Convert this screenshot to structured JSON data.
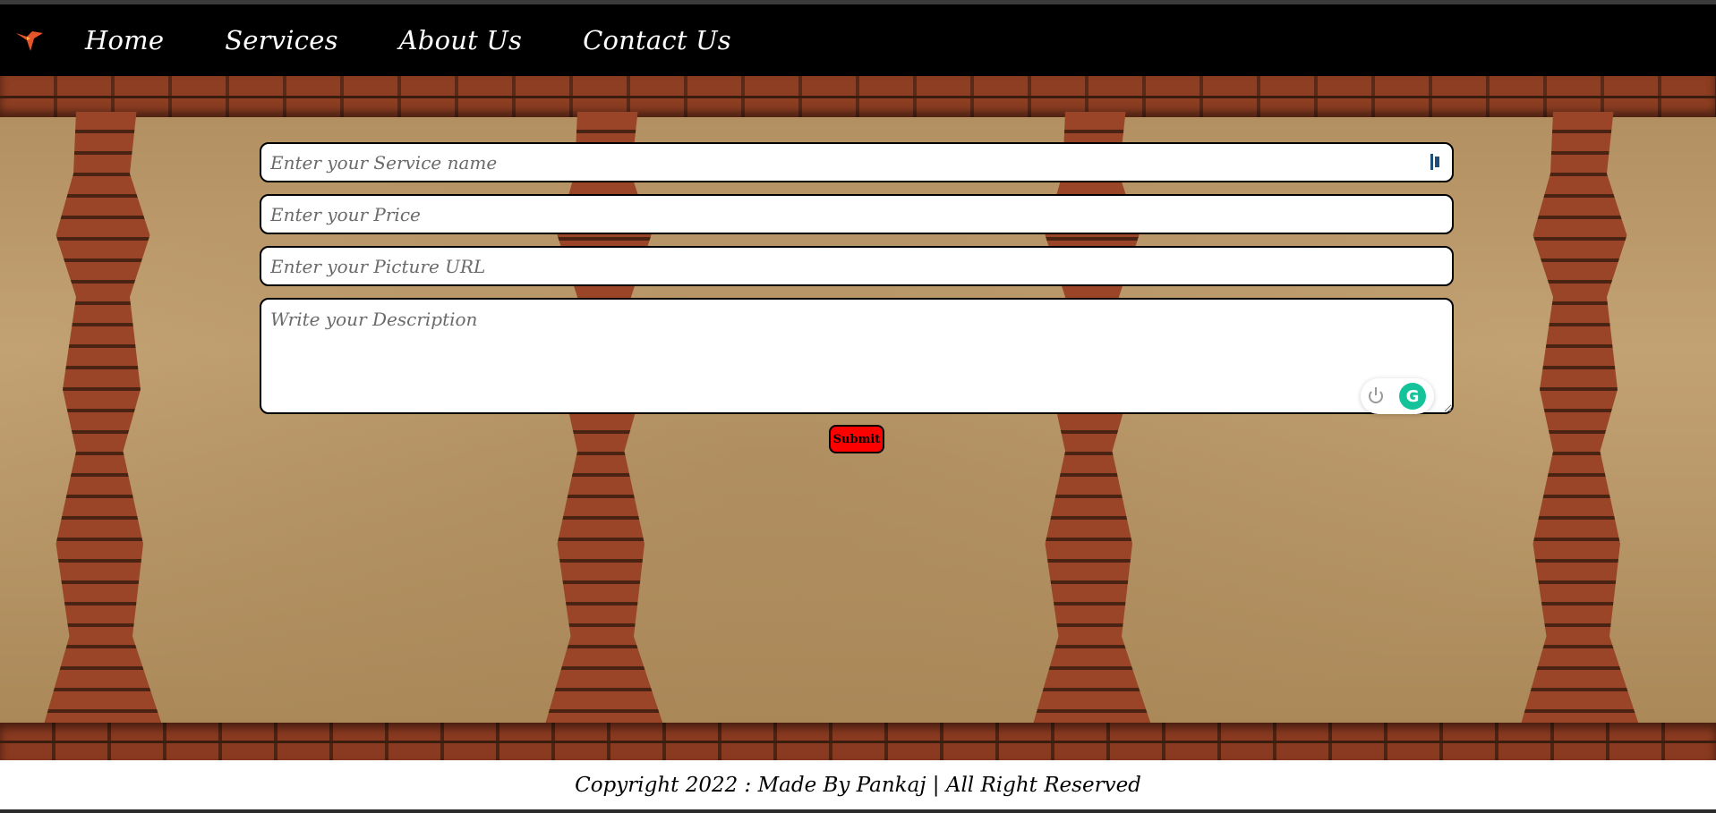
{
  "nav": {
    "logo": "hummingbird-logo",
    "links": [
      "Home",
      "Services",
      "About Us",
      "Contact Us"
    ]
  },
  "form": {
    "service_name_placeholder": "Enter your Service name",
    "price_placeholder": "Enter your Price",
    "picture_url_placeholder": "Enter your Picture URL",
    "description_placeholder": "Write your Description",
    "submit_label": "Submit"
  },
  "grammarly": {
    "power_icon": "power-icon",
    "logo_letter": "G"
  },
  "footer": {
    "text": "Copyright 2022 : Made By Pankaj | All Right Reserved"
  },
  "colors": {
    "navbar": "#000000",
    "submit": "#ff0000",
    "grammarly": "#15c39a"
  }
}
